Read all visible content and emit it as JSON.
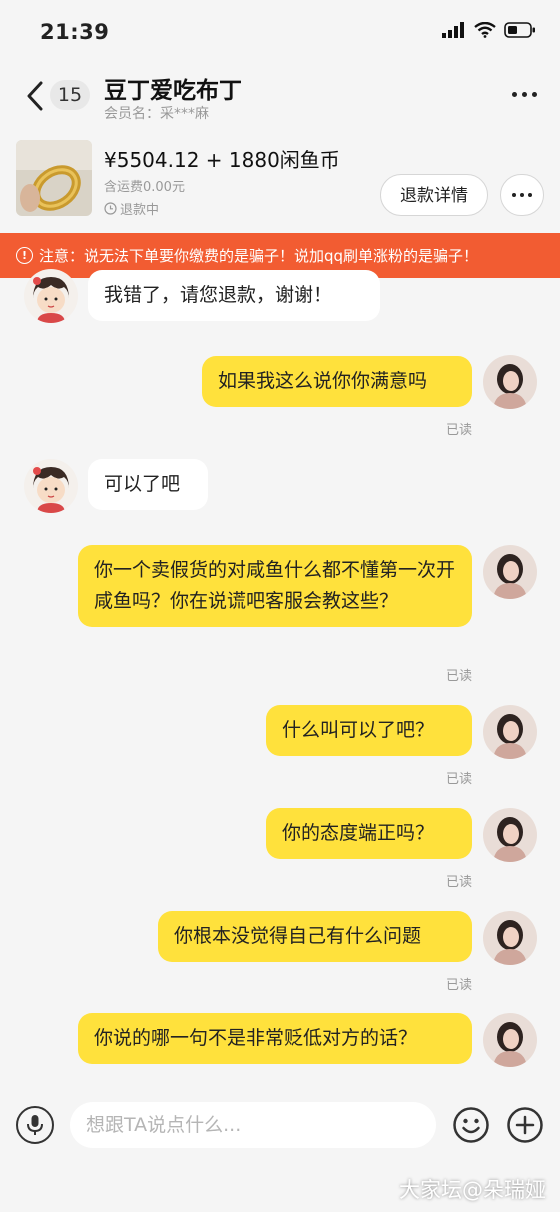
{
  "status_bar": {
    "time": "21:39"
  },
  "header": {
    "back_icon": "chevron-left-icon",
    "unread_count": "15",
    "title": "豆丁爱吃布丁",
    "member_label": "会员名：",
    "member_name": "采***麻",
    "more_icon": "more-horizontal-icon"
  },
  "product": {
    "price": "¥5504.12 + 1880闲鱼币",
    "shipping": "含运费0.00元",
    "status": "退款中",
    "refund_button": "退款详情"
  },
  "warning": {
    "text": "注意：说无法下单要你缴费的是骗子！说加qq刷单涨粉的是骗子！",
    "color": "#f25c32"
  },
  "messages": [
    {
      "side": "left",
      "text": "我错了，请您退款，谢谢！"
    },
    {
      "side": "right",
      "text": "如果我这么说你你满意吗",
      "read": "已读"
    },
    {
      "side": "left",
      "text": "可以了吧"
    },
    {
      "side": "right",
      "text": "你一个卖假货的对咸鱼什么都不懂第一次开咸鱼吗？你在说谎吧客服会教这些？",
      "read": "已读"
    },
    {
      "side": "right",
      "text": "什么叫可以了吧？",
      "read": "已读"
    },
    {
      "side": "right",
      "text": "你的态度端正吗？",
      "read": "已读"
    },
    {
      "side": "right",
      "text": "你根本没觉得自己有什么问题",
      "read": "已读"
    },
    {
      "side": "right",
      "text": "你说的哪一句不是非常贬低对方的话？"
    }
  ],
  "input": {
    "placeholder": "想跟TA说点什么..."
  },
  "watermark": "大家坛@朵瑞娅",
  "colors": {
    "my_bubble": "#ffe13c",
    "their_bubble": "#ffffff",
    "background": "#f5f5f5"
  }
}
